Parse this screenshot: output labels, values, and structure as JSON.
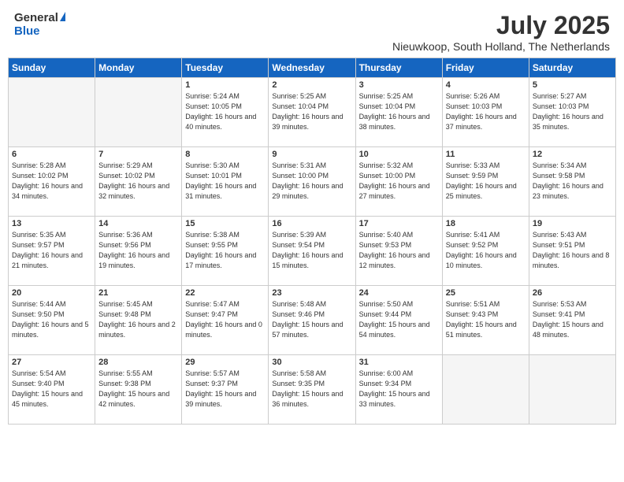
{
  "header": {
    "logo_general": "General",
    "logo_blue": "Blue",
    "month_title": "July 2025",
    "location": "Nieuwkoop, South Holland, The Netherlands"
  },
  "days_of_week": [
    "Sunday",
    "Monday",
    "Tuesday",
    "Wednesday",
    "Thursday",
    "Friday",
    "Saturday"
  ],
  "weeks": [
    [
      {
        "num": "",
        "empty": true
      },
      {
        "num": "",
        "empty": true
      },
      {
        "num": "1",
        "sunrise": "5:24 AM",
        "sunset": "10:05 PM",
        "daylight": "16 hours and 40 minutes."
      },
      {
        "num": "2",
        "sunrise": "5:25 AM",
        "sunset": "10:04 PM",
        "daylight": "16 hours and 39 minutes."
      },
      {
        "num": "3",
        "sunrise": "5:25 AM",
        "sunset": "10:04 PM",
        "daylight": "16 hours and 38 minutes."
      },
      {
        "num": "4",
        "sunrise": "5:26 AM",
        "sunset": "10:03 PM",
        "daylight": "16 hours and 37 minutes."
      },
      {
        "num": "5",
        "sunrise": "5:27 AM",
        "sunset": "10:03 PM",
        "daylight": "16 hours and 35 minutes."
      }
    ],
    [
      {
        "num": "6",
        "sunrise": "5:28 AM",
        "sunset": "10:02 PM",
        "daylight": "16 hours and 34 minutes."
      },
      {
        "num": "7",
        "sunrise": "5:29 AM",
        "sunset": "10:02 PM",
        "daylight": "16 hours and 32 minutes."
      },
      {
        "num": "8",
        "sunrise": "5:30 AM",
        "sunset": "10:01 PM",
        "daylight": "16 hours and 31 minutes."
      },
      {
        "num": "9",
        "sunrise": "5:31 AM",
        "sunset": "10:00 PM",
        "daylight": "16 hours and 29 minutes."
      },
      {
        "num": "10",
        "sunrise": "5:32 AM",
        "sunset": "10:00 PM",
        "daylight": "16 hours and 27 minutes."
      },
      {
        "num": "11",
        "sunrise": "5:33 AM",
        "sunset": "9:59 PM",
        "daylight": "16 hours and 25 minutes."
      },
      {
        "num": "12",
        "sunrise": "5:34 AM",
        "sunset": "9:58 PM",
        "daylight": "16 hours and 23 minutes."
      }
    ],
    [
      {
        "num": "13",
        "sunrise": "5:35 AM",
        "sunset": "9:57 PM",
        "daylight": "16 hours and 21 minutes."
      },
      {
        "num": "14",
        "sunrise": "5:36 AM",
        "sunset": "9:56 PM",
        "daylight": "16 hours and 19 minutes."
      },
      {
        "num": "15",
        "sunrise": "5:38 AM",
        "sunset": "9:55 PM",
        "daylight": "16 hours and 17 minutes."
      },
      {
        "num": "16",
        "sunrise": "5:39 AM",
        "sunset": "9:54 PM",
        "daylight": "16 hours and 15 minutes."
      },
      {
        "num": "17",
        "sunrise": "5:40 AM",
        "sunset": "9:53 PM",
        "daylight": "16 hours and 12 minutes."
      },
      {
        "num": "18",
        "sunrise": "5:41 AM",
        "sunset": "9:52 PM",
        "daylight": "16 hours and 10 minutes."
      },
      {
        "num": "19",
        "sunrise": "5:43 AM",
        "sunset": "9:51 PM",
        "daylight": "16 hours and 8 minutes."
      }
    ],
    [
      {
        "num": "20",
        "sunrise": "5:44 AM",
        "sunset": "9:50 PM",
        "daylight": "16 hours and 5 minutes."
      },
      {
        "num": "21",
        "sunrise": "5:45 AM",
        "sunset": "9:48 PM",
        "daylight": "16 hours and 2 minutes."
      },
      {
        "num": "22",
        "sunrise": "5:47 AM",
        "sunset": "9:47 PM",
        "daylight": "16 hours and 0 minutes."
      },
      {
        "num": "23",
        "sunrise": "5:48 AM",
        "sunset": "9:46 PM",
        "daylight": "15 hours and 57 minutes."
      },
      {
        "num": "24",
        "sunrise": "5:50 AM",
        "sunset": "9:44 PM",
        "daylight": "15 hours and 54 minutes."
      },
      {
        "num": "25",
        "sunrise": "5:51 AM",
        "sunset": "9:43 PM",
        "daylight": "15 hours and 51 minutes."
      },
      {
        "num": "26",
        "sunrise": "5:53 AM",
        "sunset": "9:41 PM",
        "daylight": "15 hours and 48 minutes."
      }
    ],
    [
      {
        "num": "27",
        "sunrise": "5:54 AM",
        "sunset": "9:40 PM",
        "daylight": "15 hours and 45 minutes."
      },
      {
        "num": "28",
        "sunrise": "5:55 AM",
        "sunset": "9:38 PM",
        "daylight": "15 hours and 42 minutes."
      },
      {
        "num": "29",
        "sunrise": "5:57 AM",
        "sunset": "9:37 PM",
        "daylight": "15 hours and 39 minutes."
      },
      {
        "num": "30",
        "sunrise": "5:58 AM",
        "sunset": "9:35 PM",
        "daylight": "15 hours and 36 minutes."
      },
      {
        "num": "31",
        "sunrise": "6:00 AM",
        "sunset": "9:34 PM",
        "daylight": "15 hours and 33 minutes."
      },
      {
        "num": "",
        "empty": true
      },
      {
        "num": "",
        "empty": true
      }
    ]
  ]
}
